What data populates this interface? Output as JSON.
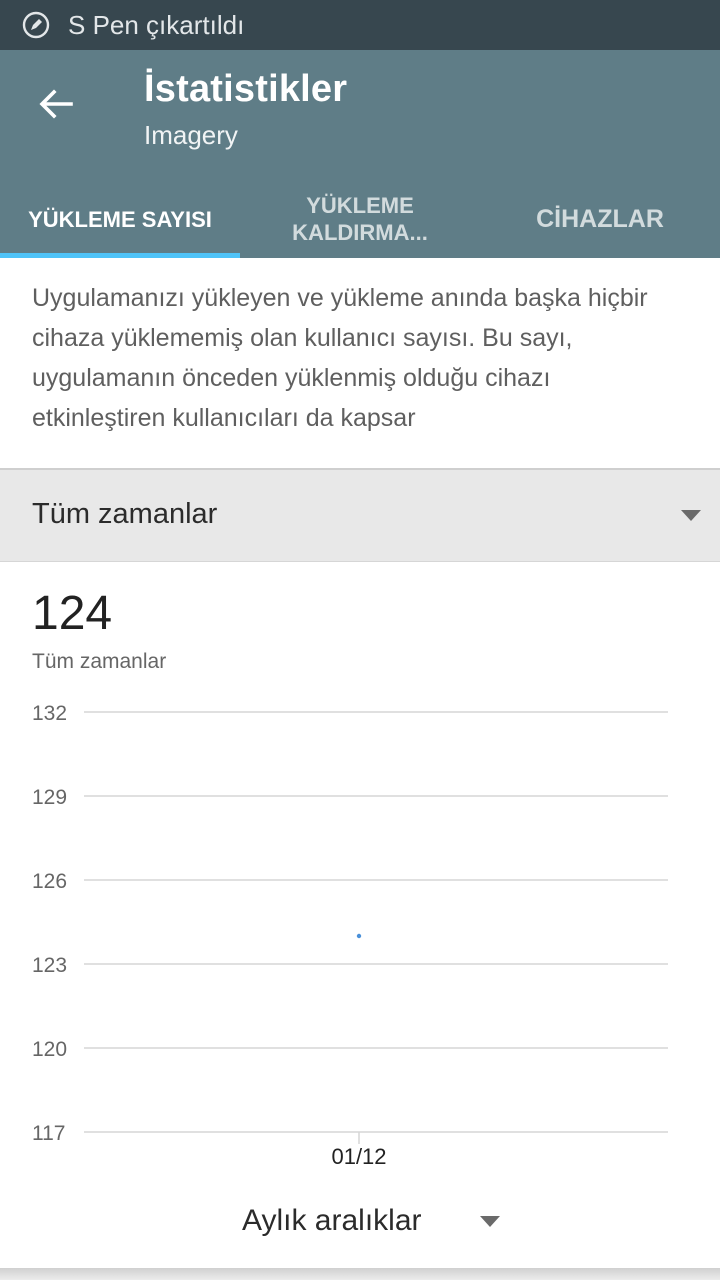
{
  "status_bar": {
    "text": "S Pen çıkartıldı",
    "icon": "spen-icon"
  },
  "app_bar": {
    "title": "İstatistikler",
    "subtitle": "Imagery",
    "back_icon": "back-arrow-icon"
  },
  "tabs": [
    {
      "label": "YÜKLEME SAYISI",
      "active": true
    },
    {
      "label": "YÜKLEME KALDIRMA...",
      "active": false
    },
    {
      "label": "CİHAZLAR",
      "active": false
    }
  ],
  "description": "Uygulamanızı yükleyen ve yükleme anında başka hiçbir cihaza yüklememiş olan kullanıcı sayısı. Bu sayı, uygulamanın önceden yüklenmiş olduğu cihazı etkinleştiren kullanıcıları da kapsar",
  "range_select": {
    "label": "Tüm zamanlar"
  },
  "summary": {
    "value": "124",
    "caption": "Tüm zamanlar"
  },
  "chart_data": {
    "type": "line",
    "categories": [
      "01/12"
    ],
    "series": [
      {
        "values": [
          124
        ]
      }
    ],
    "yticks": [
      132,
      129,
      126,
      123,
      120,
      117
    ],
    "ylim": [
      117,
      132
    ],
    "grid": true,
    "color": "#4a90d9"
  },
  "interval_select": {
    "label": "Aylık aralıklar"
  },
  "colors": {
    "status_bar": "#37474f",
    "app_bar": "#5f7d87",
    "tab_indicator": "#4fc3f7",
    "range_bg": "#e8e8e8"
  }
}
